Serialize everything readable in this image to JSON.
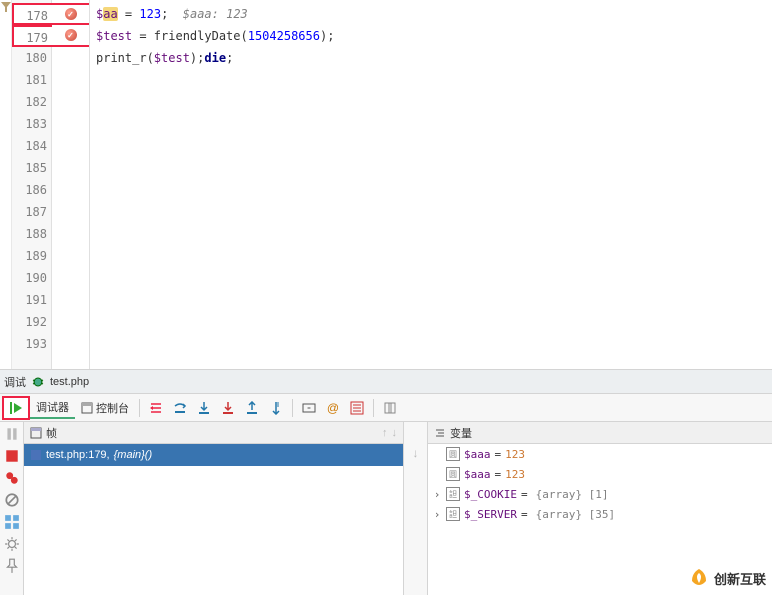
{
  "editor": {
    "lines": [
      {
        "num": "178",
        "bp": true,
        "hl": true,
        "tokens": [
          {
            "t": "$",
            "c": "k-var"
          },
          {
            "t": "aa",
            "c": "k-var",
            "bookmark": true
          },
          {
            "t": " = ",
            "c": ""
          },
          {
            "t": "123",
            "c": "k-num"
          },
          {
            "t": ";  ",
            "c": ""
          },
          {
            "t": "$aaa: 123",
            "c": "k-comment"
          }
        ]
      },
      {
        "num": "179",
        "bp": true,
        "hl": true,
        "tokens": [
          {
            "t": "$test",
            "c": "k-var"
          },
          {
            "t": " = friendlyDate(",
            "c": ""
          },
          {
            "t": "1504258656",
            "c": "k-num"
          },
          {
            "t": ");",
            "c": ""
          }
        ]
      },
      {
        "num": "180",
        "tokens": [
          {
            "t": "print_r(",
            "c": ""
          },
          {
            "t": "$test",
            "c": "k-var"
          },
          {
            "t": ");",
            "c": ""
          },
          {
            "t": "die",
            "c": "k-die"
          },
          {
            "t": ";",
            "c": ""
          }
        ]
      },
      {
        "num": "181"
      },
      {
        "num": "182"
      },
      {
        "num": "183"
      },
      {
        "num": "184"
      },
      {
        "num": "185"
      },
      {
        "num": "186"
      },
      {
        "num": "187"
      },
      {
        "num": "188"
      },
      {
        "num": "189"
      },
      {
        "num": "190"
      },
      {
        "num": "191"
      },
      {
        "num": "192"
      },
      {
        "num": "193"
      }
    ]
  },
  "tabs": {
    "debug_label": "调试",
    "file_label": "test.php"
  },
  "subtabs": {
    "debugger": "调试器",
    "console": "控制台"
  },
  "frames": {
    "title": "帧",
    "row_file": "test.php:179,",
    "row_fn": "{main}()"
  },
  "vars": {
    "title": "变量",
    "items": [
      {
        "expand": "",
        "icon": "圆",
        "name": "$aaa",
        "eq": "=",
        "val": "123",
        "type": ""
      },
      {
        "expand": "",
        "icon": "圆",
        "name": "$aaa",
        "eq": "=",
        "val": "123",
        "type": ""
      },
      {
        "expand": "›",
        "icon": "詚",
        "name": "$_COOKIE",
        "eq": "=",
        "val": "",
        "type": "{array} [1]"
      },
      {
        "expand": "›",
        "icon": "詚",
        "name": "$_SERVER",
        "eq": "=",
        "val": "",
        "type": "{array} [35]"
      }
    ]
  },
  "watermark": "创新互联"
}
